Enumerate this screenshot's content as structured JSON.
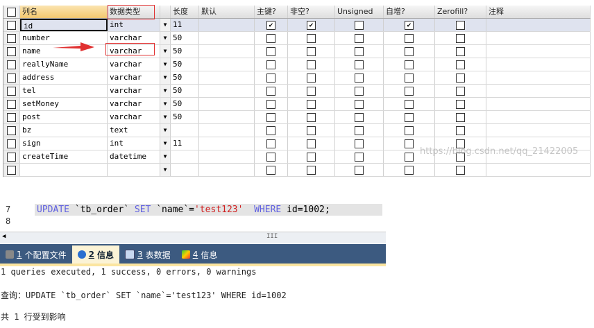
{
  "table_designer": {
    "headers": [
      "列名",
      "数据类型",
      "长度",
      "默认",
      "主键?",
      "非空?",
      "Unsigned",
      "自增?",
      "Zerofill?",
      "注释"
    ],
    "rows": [
      {
        "name": "id",
        "type": "int",
        "length": "11",
        "pk": true,
        "notnull": true,
        "unsigned": false,
        "autoinc": true,
        "zerofill": false
      },
      {
        "name": "number",
        "type": "varchar",
        "length": "50",
        "pk": false,
        "notnull": false,
        "unsigned": false,
        "autoinc": false,
        "zerofill": false
      },
      {
        "name": "name",
        "type": "varchar",
        "length": "50",
        "pk": false,
        "notnull": false,
        "unsigned": false,
        "autoinc": false,
        "zerofill": false
      },
      {
        "name": "reallyName",
        "type": "varchar",
        "length": "50",
        "pk": false,
        "notnull": false,
        "unsigned": false,
        "autoinc": false,
        "zerofill": false
      },
      {
        "name": "address",
        "type": "varchar",
        "length": "50",
        "pk": false,
        "notnull": false,
        "unsigned": false,
        "autoinc": false,
        "zerofill": false
      },
      {
        "name": "tel",
        "type": "varchar",
        "length": "50",
        "pk": false,
        "notnull": false,
        "unsigned": false,
        "autoinc": false,
        "zerofill": false
      },
      {
        "name": "setMoney",
        "type": "varchar",
        "length": "50",
        "pk": false,
        "notnull": false,
        "unsigned": false,
        "autoinc": false,
        "zerofill": false
      },
      {
        "name": "post",
        "type": "varchar",
        "length": "50",
        "pk": false,
        "notnull": false,
        "unsigned": false,
        "autoinc": false,
        "zerofill": false
      },
      {
        "name": "bz",
        "type": "text",
        "length": "",
        "pk": false,
        "notnull": false,
        "unsigned": false,
        "autoinc": false,
        "zerofill": false
      },
      {
        "name": "sign",
        "type": "int",
        "length": "11",
        "pk": false,
        "notnull": false,
        "unsigned": false,
        "autoinc": false,
        "zerofill": false
      },
      {
        "name": "createTime",
        "type": "datetime",
        "length": "",
        "pk": false,
        "notnull": false,
        "unsigned": false,
        "autoinc": false,
        "zerofill": false
      },
      {
        "name": "",
        "type": "",
        "length": "",
        "pk": false,
        "notnull": false,
        "unsigned": false,
        "autoinc": false,
        "zerofill": false
      }
    ],
    "watermark": "https://blog.csdn.net/qq_21422005"
  },
  "editor": {
    "lines": [
      "7",
      "8"
    ],
    "sql": {
      "kw1": "UPDATE",
      "t1": " `tb_order` ",
      "kw2": "SET",
      "t2": " `name`=",
      "str": "'test123'",
      "t3": "  ",
      "kw3": "WHERE",
      "t4": " id=1002;"
    },
    "scroll_grip": "III"
  },
  "tabs": [
    {
      "num": "1",
      "label": " 个配置文件",
      "color": "#777"
    },
    {
      "num": "2",
      "label": " 信息",
      "color": "#2a6fd0"
    },
    {
      "num": "3",
      "label": " 表数据",
      "color": "#4a6fa8"
    },
    {
      "num": "4",
      "label": " 信息",
      "color": "#e04040"
    }
  ],
  "output": {
    "summary": "1 queries executed, 1 success, 0 errors, 0 warnings",
    "query": "查询：UPDATE `tb_order` SET `name`='test123' WHERE id=1002",
    "affected": "共 1 行受到影响"
  }
}
